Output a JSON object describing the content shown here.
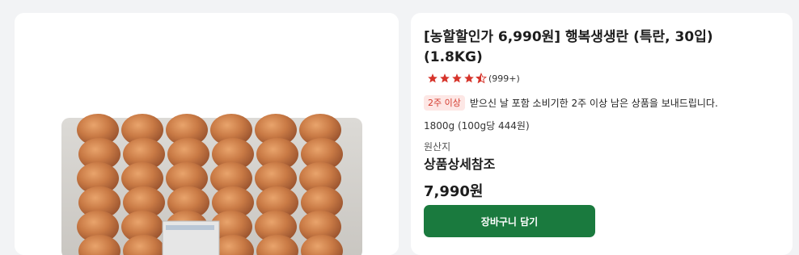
{
  "product": {
    "title": "[농할할인가 6,990원] 행복생생란 (특란, 30입) (1.8KG)",
    "rating": 4.5,
    "review_count": "(999+)",
    "shelf_badge": "2주 이상",
    "shelf_text": "받으신 날 포함 소비기한 2주 이상 남은 상품을 보내드립니다.",
    "weight_info": "1800g (100g당 444원)",
    "origin_label": "원산지",
    "origin_value": "상품상세참조",
    "price": "7,990원",
    "cart_button_label": "장바구니 담기",
    "image_icon": "egg-tray-image"
  },
  "colors": {
    "star": "#d6342b",
    "badge_bg": "#fde7e5",
    "badge_text": "#d43c2f",
    "button": "#1a7a3e",
    "page_bg": "#f2f3f5"
  }
}
